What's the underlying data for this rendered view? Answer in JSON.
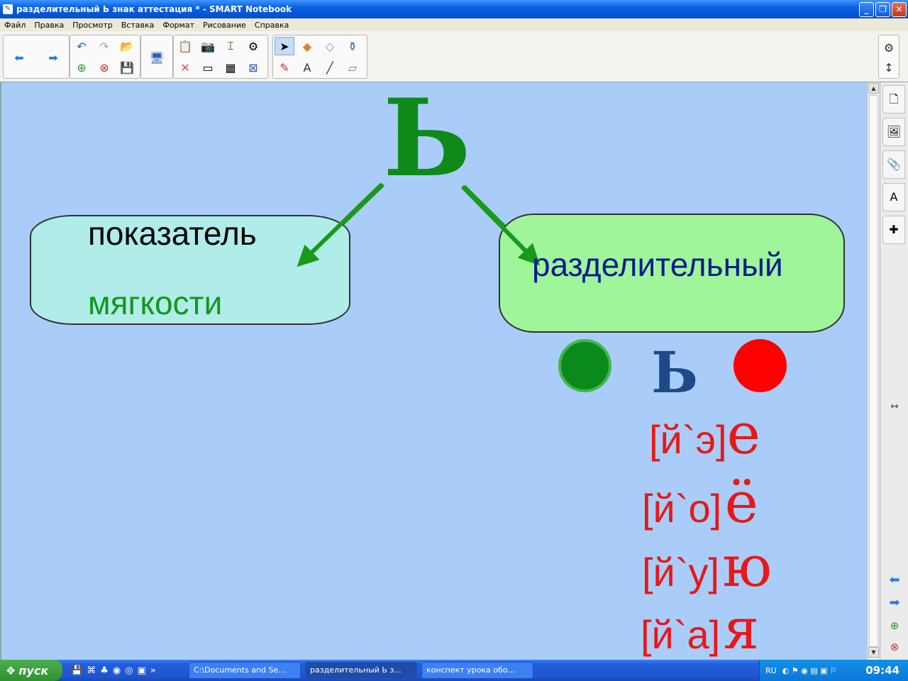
{
  "window": {
    "title": "разделительный Ь знак аттестация * - SMART Notebook",
    "app_icon": "notebook-icon"
  },
  "menu": [
    "Файл",
    "Правка",
    "Просмотр",
    "Вставка",
    "Формат",
    "Рисование",
    "Справка"
  ],
  "toolbar": {
    "icons": [
      "back-icon",
      "forward-icon",
      "undo-icon",
      "redo-icon",
      "open-icon",
      "new-page-icon",
      "delete-page-icon",
      "save-icon",
      "screen-icon",
      "paste-icon",
      "screenshot-icon",
      "document-camera-icon",
      "measure-icon",
      "delete-icon",
      "screen-shade-icon",
      "table-icon",
      "close-icon",
      "select-icon",
      "shapes-icon",
      "eraser-icon",
      "fill-icon",
      "pens-icon",
      "text-icon",
      "line-icon",
      "magic-eraser-icon"
    ],
    "settings_icons": [
      "gear-icon",
      "move-toolbar-icon"
    ]
  },
  "canvas": {
    "big_letter": "Ь",
    "box_left_line1": "показатель",
    "box_left_line2": "мягкости",
    "box_right": "разделительный",
    "middle_letter": "Ь",
    "phonetics": [
      {
        "transcription": "[й`э]",
        "letter": "е"
      },
      {
        "transcription": "[й`о]",
        "letter": "ё"
      },
      {
        "transcription": "[й`у]",
        "letter": "ю"
      },
      {
        "transcription": "[й`а]",
        "letter": "я"
      }
    ],
    "colors": {
      "background": "#a9cdf8",
      "soft_sign": "#0f8a1a",
      "arrow": "#1a9a1a",
      "box_left": "#b0ece8",
      "box_right": "#9ef59a",
      "red": "#e81818",
      "green_circle": "#0a8a1a",
      "red_circle": "#ff0000"
    }
  },
  "sidebar": {
    "tabs": [
      "page-sorter-icon",
      "gallery-icon",
      "attachments-icon",
      "properties-icon",
      "addons-icon"
    ],
    "nav": [
      "previous-page-icon",
      "next-page-icon",
      "add-page-icon",
      "delete-page-icon"
    ]
  },
  "taskbar": {
    "start_label": "пуск",
    "tasks": [
      "C:\\Documents and Se...",
      "разделительный Ь з...",
      "конспект урока обо..."
    ],
    "language": "RU",
    "clock": "09:44"
  }
}
